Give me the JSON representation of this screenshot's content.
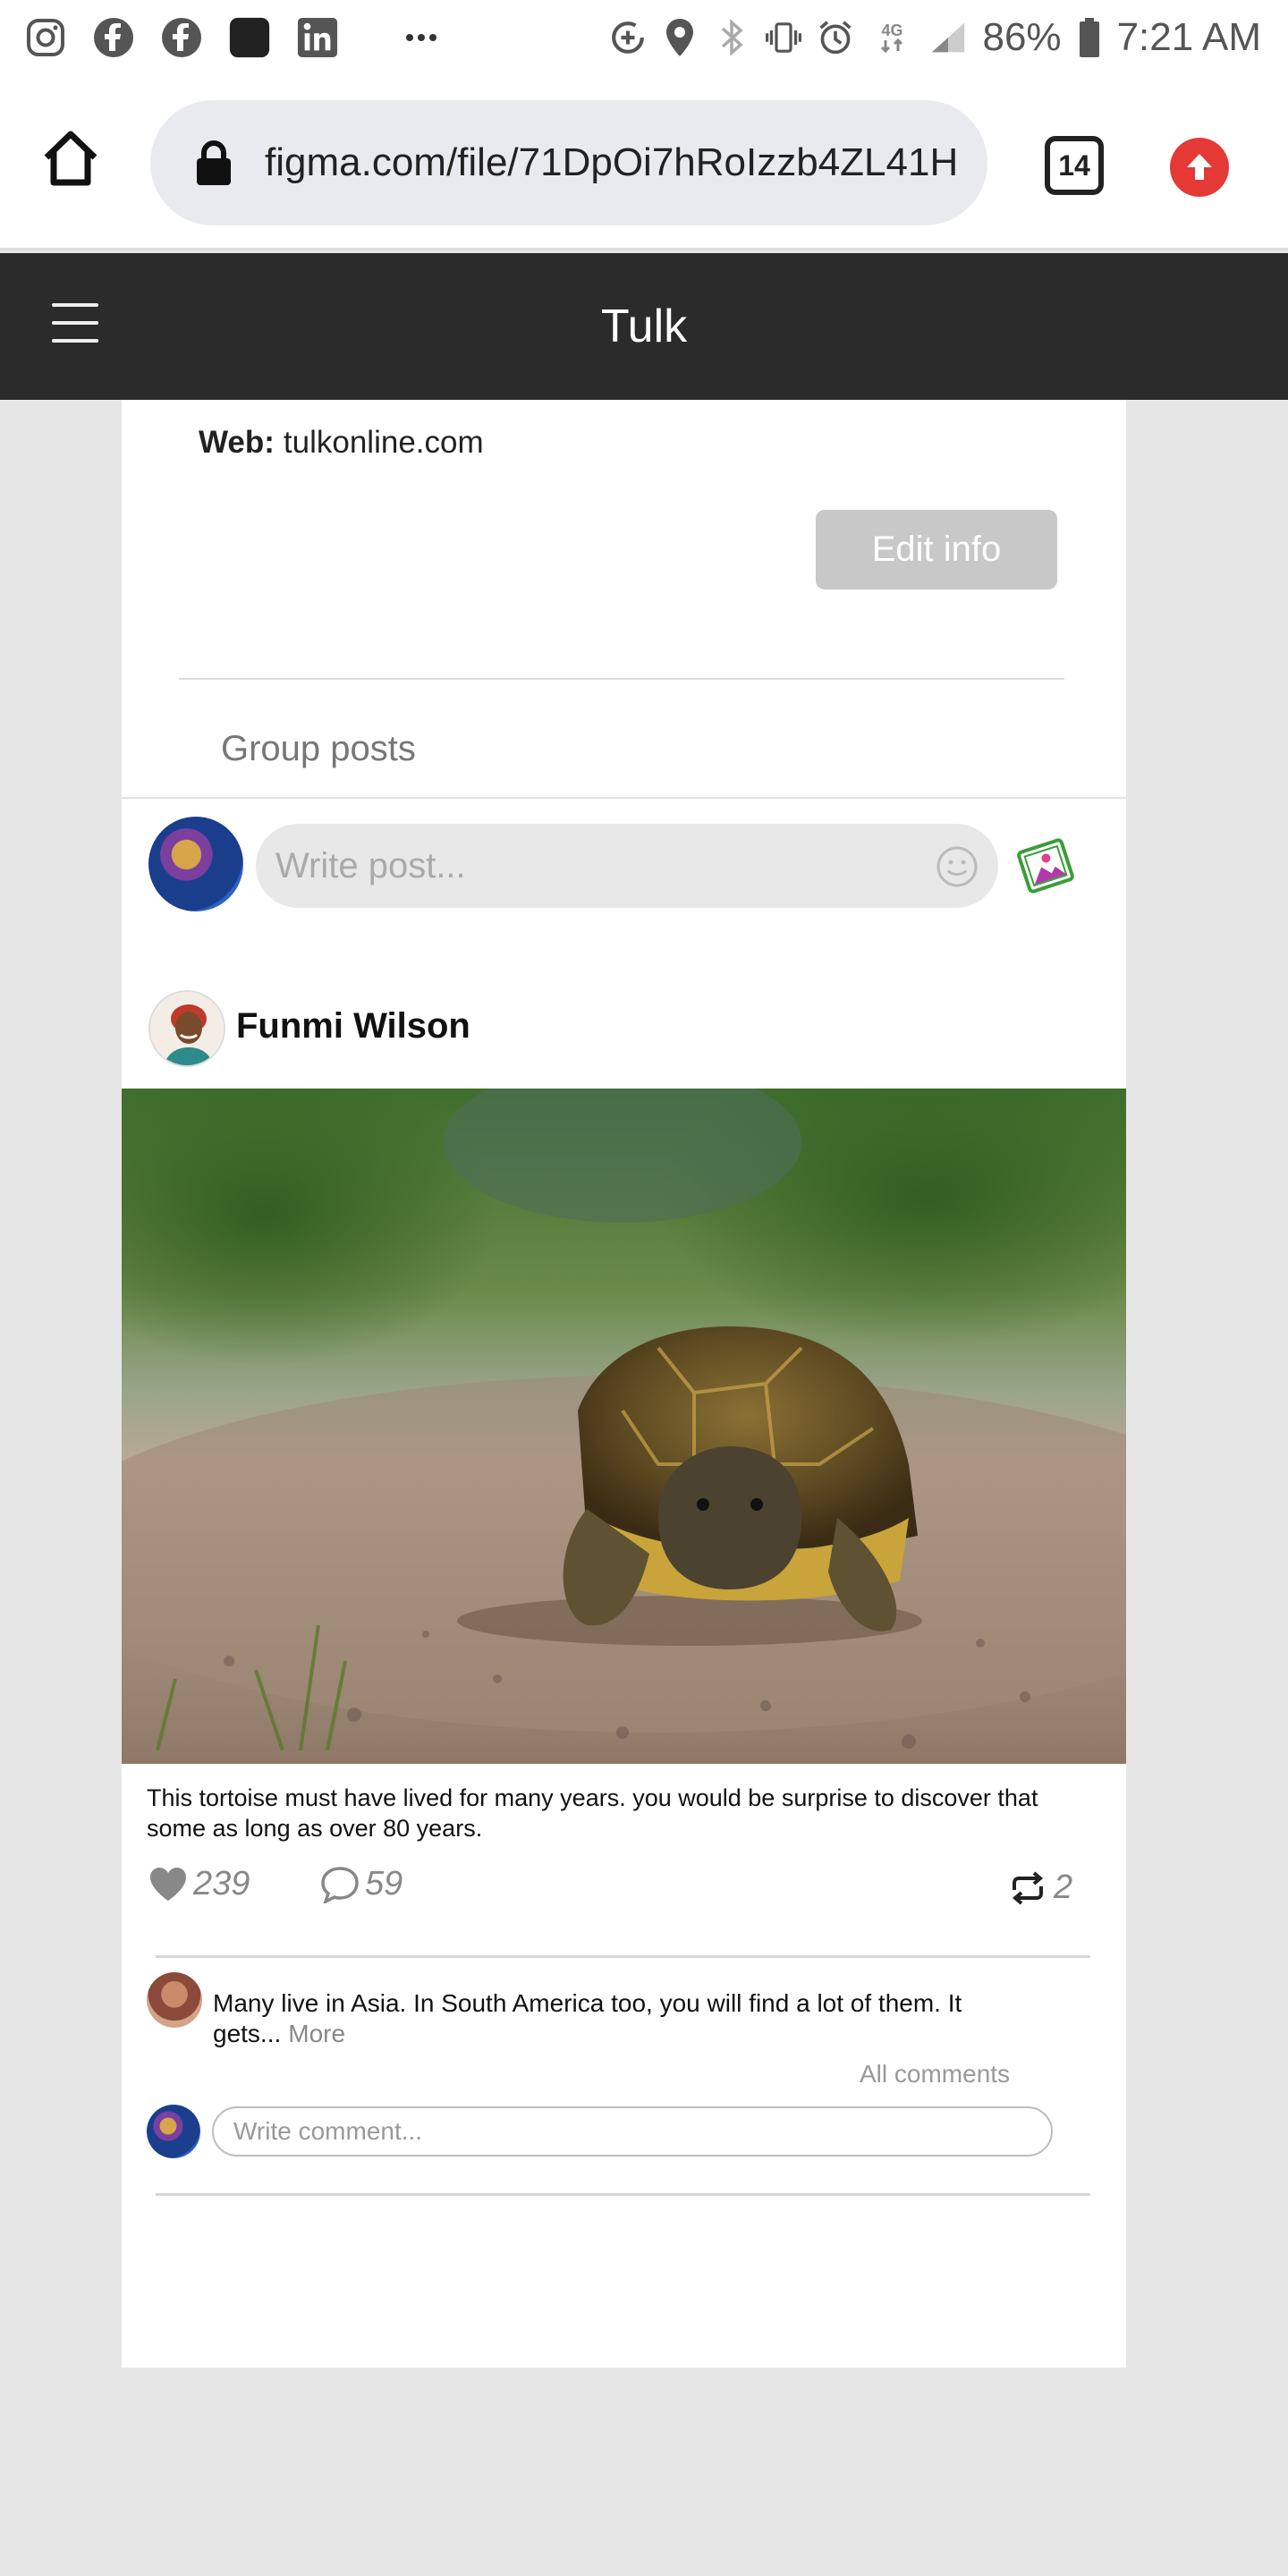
{
  "status_bar": {
    "battery": "86%",
    "time": "7:21 AM",
    "network": "4G",
    "left_icons": [
      "instagram-icon",
      "facebook-icon",
      "facebook-icon",
      "app-icon",
      "linkedin-icon",
      "more-icon"
    ],
    "right_icons": [
      "data-saver-icon",
      "location-icon",
      "bluetooth-icon",
      "vibrate-icon",
      "alarm-icon",
      "signal-icon",
      "battery-icon"
    ]
  },
  "browser": {
    "url": "figma.com/file/71DpOi7hRoIzzb4ZL41H",
    "tab_count": "14"
  },
  "app": {
    "title": "Tulk"
  },
  "info": {
    "web_label": "Web:",
    "web_value": "tulkonline.com",
    "edit_button": "Edit info"
  },
  "section": {
    "title": "Group posts"
  },
  "composer": {
    "placeholder": "Write post..."
  },
  "post": {
    "author": "Funmi Wilson",
    "caption": "This tortoise must have lived for many years. you would be surprise to discover that some as long as over 80 years.",
    "likes": "239",
    "comments": "59",
    "shares": "2",
    "colors": {
      "accent_green": "#3a9d3a",
      "accent_purple": "#b03aa6"
    }
  },
  "comment": {
    "text": "Many live in Asia. In South America too, you will find a lot of them. It gets...",
    "more_label": "More",
    "all_comments_label": "All comments",
    "placeholder": "Write comment..."
  }
}
